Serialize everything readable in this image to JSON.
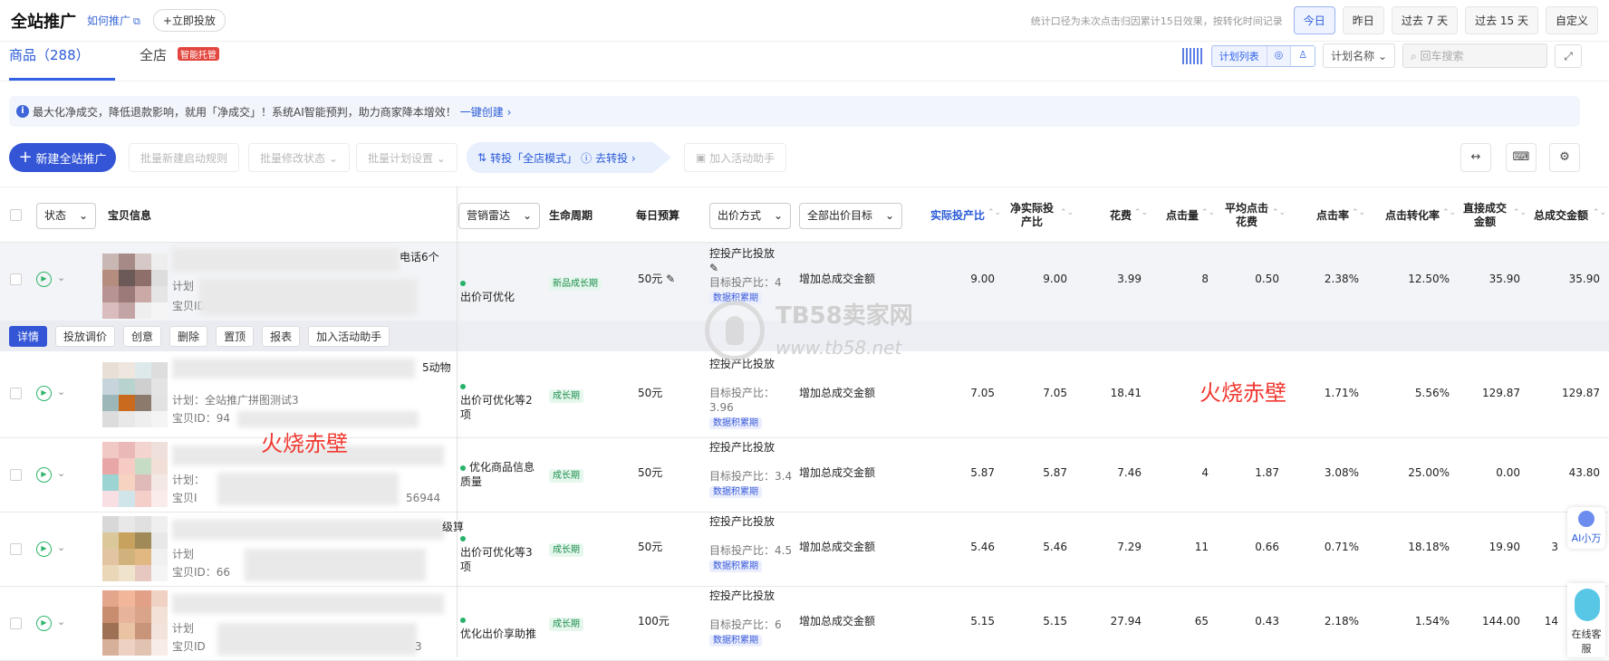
{
  "header": {
    "title": "全站推广",
    "howto": "如何推广",
    "launch": "+立即投放",
    "note": "统计口径为未次点击归因累计15日效果，按转化时间记录",
    "ranges": [
      "今日",
      "昨日",
      "过去 7 天",
      "过去 15 天",
      "自定义"
    ],
    "active_range": "今日"
  },
  "tabs": {
    "items": [
      "商品（288）",
      "全店"
    ],
    "badge": "智能托管",
    "view_seg": [
      "计划列表",
      "◎",
      "♙"
    ],
    "plan_select": "计划名称",
    "search_placeholder": "回车搜索"
  },
  "info": {
    "text": "最大化净成交，降低退款影响，就用「净成交」！系统AI智能预判，助力商家降本增效！",
    "link": "一键创建 ›"
  },
  "actions": {
    "new_button": "新建全站推广",
    "bulk": [
      "批量新建启动规则",
      "批量修改状态 ⌄",
      "批量计划设置 ⌄"
    ],
    "transfer": "转投「全店模式」",
    "transfer_link": "去转投 ›",
    "activity": "加入活动助手"
  },
  "columns": {
    "status": "状态",
    "item": "宝贝信息",
    "radar": "营销雷达",
    "lifecycle": "生命周期",
    "budget": "每日预算",
    "bid_mode": "出价方式",
    "bid_goal": "全部出价目标",
    "roi": "实际投产比",
    "net_roi": "净实际投产比",
    "spend": "花费",
    "clicks": "点击量",
    "cpc": "平均点击花费",
    "ctr": "点击率",
    "cvr": "点击转化率",
    "direct_gmv": "直接成交金额",
    "total_gmv": "总成交金额"
  },
  "row_actions": [
    "详情",
    "投放调价",
    "创意",
    "删除",
    "置顶",
    "报表",
    "加入活动助手"
  ],
  "rows": [
    {
      "name_tail": "电话6个",
      "plan": "计划",
      "id": "宝贝ID",
      "id_tail": "",
      "radar": "出价可优化",
      "lifecycle": "新品成长期",
      "budget": "50元",
      "bid_mode": "控投产比投放",
      "target": "目标投产比：4",
      "data_tag": "数据积累期",
      "goal": "增加总成交金额",
      "roi": "9.00",
      "net_roi": "9.00",
      "spend": "3.99",
      "clicks": "8",
      "cpc": "0.50",
      "ctr": "2.38%",
      "cvr": "12.50%",
      "direct": "35.90",
      "total": "35.90"
    },
    {
      "name_tail": "5动物",
      "plan": "计划：全站推广拼图测试3",
      "id": "宝贝ID：94",
      "id_tail": "",
      "radar": "出价可优化等2项",
      "lifecycle": "成长期",
      "budget": "50元",
      "bid_mode": "控投产比投放",
      "target": "目标投产比：3.96",
      "data_tag": "数据积累期",
      "goal": "增加总成交金额",
      "roi": "7.05",
      "net_roi": "7.05",
      "spend": "18.41",
      "clicks": "",
      "cpc": "",
      "ctr": "1.71%",
      "cvr": "5.56%",
      "direct": "129.87",
      "total": "129.87"
    },
    {
      "name_tail": "",
      "plan": "计划：",
      "id": "宝贝I",
      "id_tail": "56944",
      "radar": "优化商品信息质量",
      "lifecycle": "成长期",
      "budget": "50元",
      "bid_mode": "控投产比投放",
      "target": "目标投产比：3.4",
      "data_tag": "数据积累期",
      "goal": "增加总成交金额",
      "roi": "5.87",
      "net_roi": "5.87",
      "spend": "7.46",
      "clicks": "4",
      "cpc": "1.87",
      "ctr": "3.08%",
      "cvr": "25.00%",
      "direct": "0.00",
      "total": "43.80"
    },
    {
      "name_tail": "级算",
      "plan": "计划",
      "id": "宝贝ID：66",
      "id_tail": "",
      "radar": "出价可优化等3项",
      "lifecycle": "成长期",
      "budget": "50元",
      "bid_mode": "控投产比投放",
      "target": "目标投产比：4.5",
      "data_tag": "数据积累期",
      "goal": "增加总成交金额",
      "roi": "5.46",
      "net_roi": "5.46",
      "spend": "7.29",
      "clicks": "11",
      "cpc": "0.66",
      "ctr": "0.71%",
      "cvr": "18.18%",
      "direct": "19.90",
      "total": "3"
    },
    {
      "name_tail": "",
      "plan": "计划",
      "id": "宝贝ID",
      "id_tail": "3",
      "radar": "优化出价享助推",
      "lifecycle": "成长期",
      "budget": "100元",
      "bid_mode": "控投产比投放",
      "target": "目标投产比：6",
      "data_tag": "数据积累期",
      "goal": "增加总成交金额",
      "roi": "5.15",
      "net_roi": "5.15",
      "spend": "27.94",
      "clicks": "65",
      "cpc": "0.43",
      "ctr": "2.18%",
      "cvr": "1.54%",
      "direct": "144.00",
      "total": "14"
    }
  ],
  "watermarks": {
    "red": "火烧赤壁",
    "site": "TB58卖家网",
    "url": "www.tb58.net"
  },
  "side": {
    "ai": "AI小万",
    "service": "在线客服"
  },
  "colors": {
    "accent": "#3456d6",
    "active": "#27b36a",
    "watermark": "#f03a32"
  }
}
